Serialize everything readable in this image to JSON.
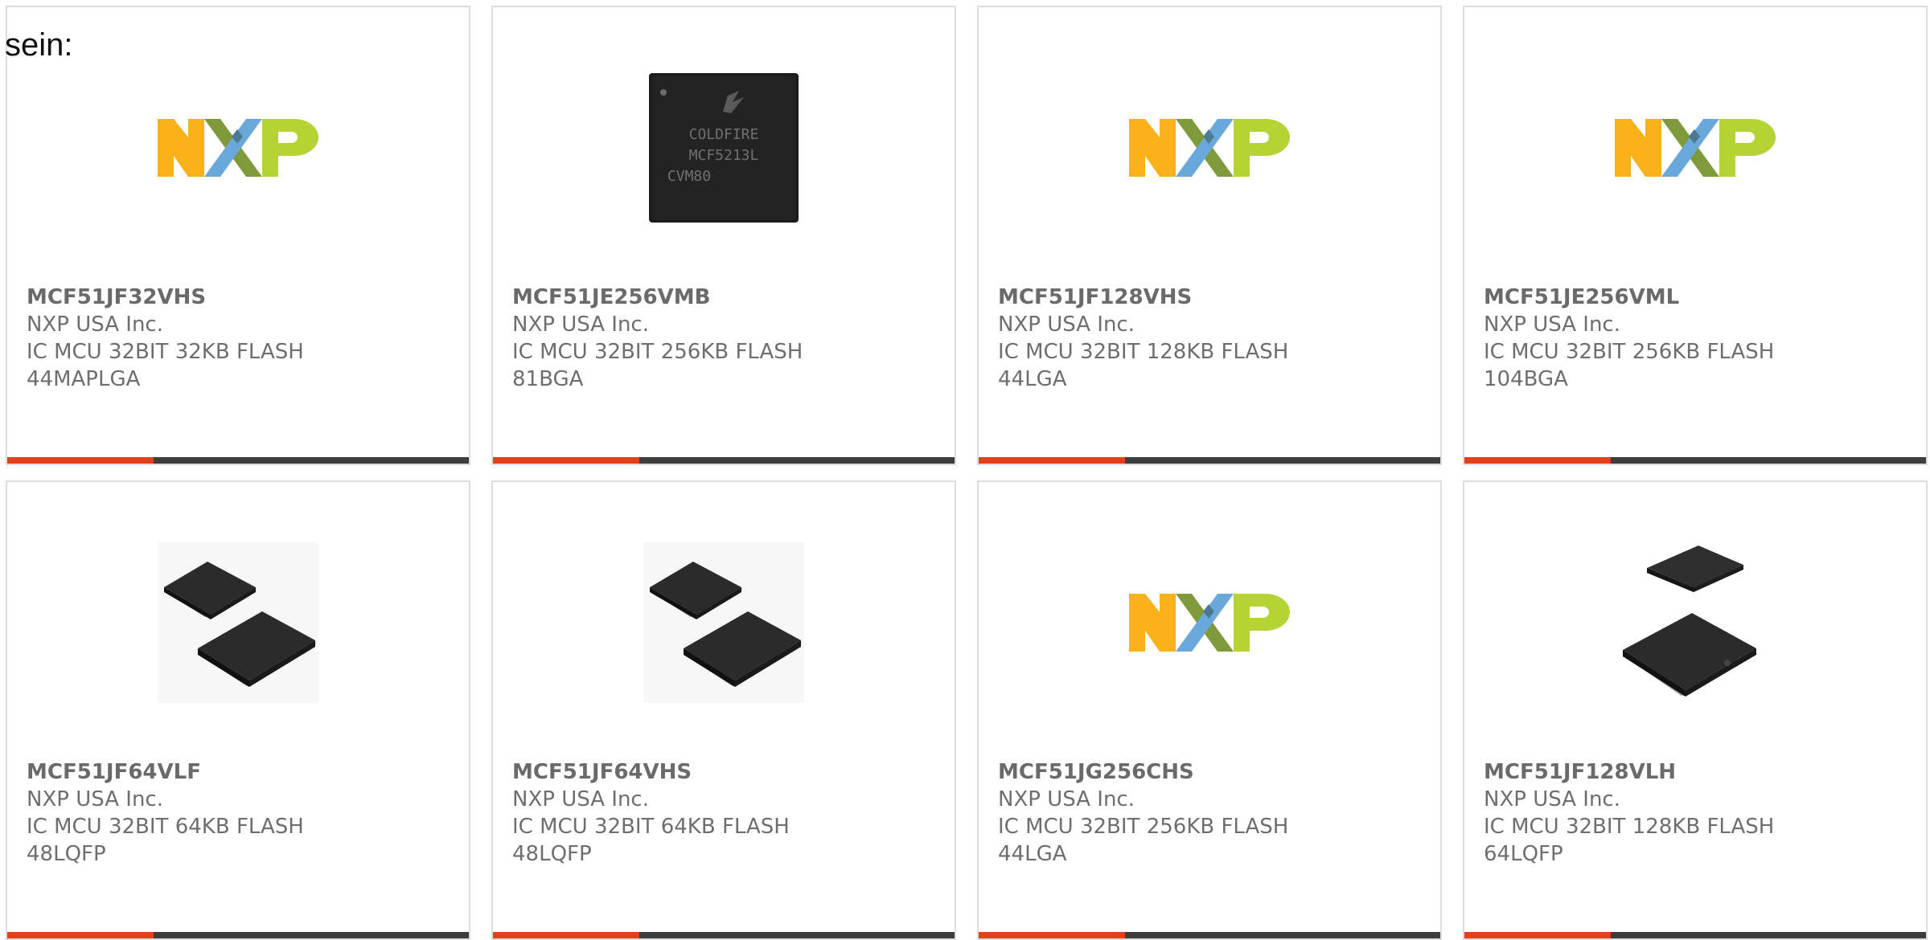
{
  "intro_text": "sein:",
  "colors": {
    "accent": "#e0411a",
    "bar": "#3d3d3d",
    "text": "#6e6e6e",
    "border": "#dcdcdc"
  },
  "products": [
    {
      "part": "MCF51JF32VHS",
      "maker": "NXP USA Inc.",
      "desc": "IC MCU 32BIT 32KB FLASH",
      "pkg": "44MAPLGA",
      "image": "nxp-logo"
    },
    {
      "part": "MCF51JE256VMB",
      "maker": "NXP USA Inc.",
      "desc": "IC MCU 32BIT 256KB FLASH",
      "pkg": "81BGA",
      "image": "coldfire-chip",
      "chip_marking": [
        "COLDFIRE",
        "MCF5213L",
        "CVM80"
      ]
    },
    {
      "part": "MCF51JF128VHS",
      "maker": "NXP USA Inc.",
      "desc": "IC MCU 32BIT 128KB FLASH",
      "pkg": "44LGA",
      "image": "nxp-logo"
    },
    {
      "part": "MCF51JE256VML",
      "maker": "NXP USA Inc.",
      "desc": "IC MCU 32BIT 256KB FLASH",
      "pkg": "104BGA",
      "image": "nxp-logo"
    },
    {
      "part": "MCF51JF64VLF",
      "maker": "NXP USA Inc.",
      "desc": "IC MCU 32BIT 64KB FLASH",
      "pkg": "48LQFP",
      "image": "qfp-pair"
    },
    {
      "part": "MCF51JF64VHS",
      "maker": "NXP USA Inc.",
      "desc": "IC MCU 32BIT 64KB FLASH",
      "pkg": "48LQFP",
      "image": "qfp-pair"
    },
    {
      "part": "MCF51JG256CHS",
      "maker": "NXP USA Inc.",
      "desc": "IC MCU 32BIT 256KB FLASH",
      "pkg": "44LGA",
      "image": "nxp-logo"
    },
    {
      "part": "MCF51JF128VLH",
      "maker": "NXP USA Inc.",
      "desc": "IC MCU 32BIT 128KB FLASH",
      "pkg": "64LQFP",
      "image": "lqfp-stack"
    }
  ]
}
